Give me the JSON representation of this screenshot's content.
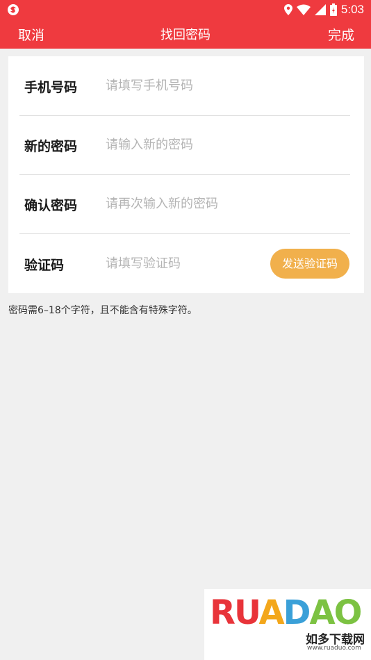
{
  "status_bar": {
    "time": "5:03",
    "icons": [
      "app-logo-icon",
      "location-icon",
      "wifi-icon",
      "signal-icon",
      "battery-icon"
    ]
  },
  "nav": {
    "cancel_label": "取消",
    "title": "找回密码",
    "done_label": "完成",
    "bar_color": "#ef3a3f"
  },
  "form": {
    "phone": {
      "label": "手机号码",
      "placeholder": "请填写手机号码",
      "value": ""
    },
    "new_password": {
      "label": "新的密码",
      "placeholder": "请输入新的密码",
      "value": ""
    },
    "confirm_password": {
      "label": "确认密码",
      "placeholder": "请再次输入新的密码",
      "value": ""
    },
    "code": {
      "label": "验证码",
      "placeholder": "请填写验证码",
      "value": ""
    },
    "send_code_label": "发送验证码",
    "send_code_color": "#f1b04c"
  },
  "hint": "密码需6–18个字符，且不能含有特殊字符。",
  "watermark": {
    "brand": "RUADAO",
    "chinese": "如多下载网",
    "url": "www.ruaduo.com"
  }
}
